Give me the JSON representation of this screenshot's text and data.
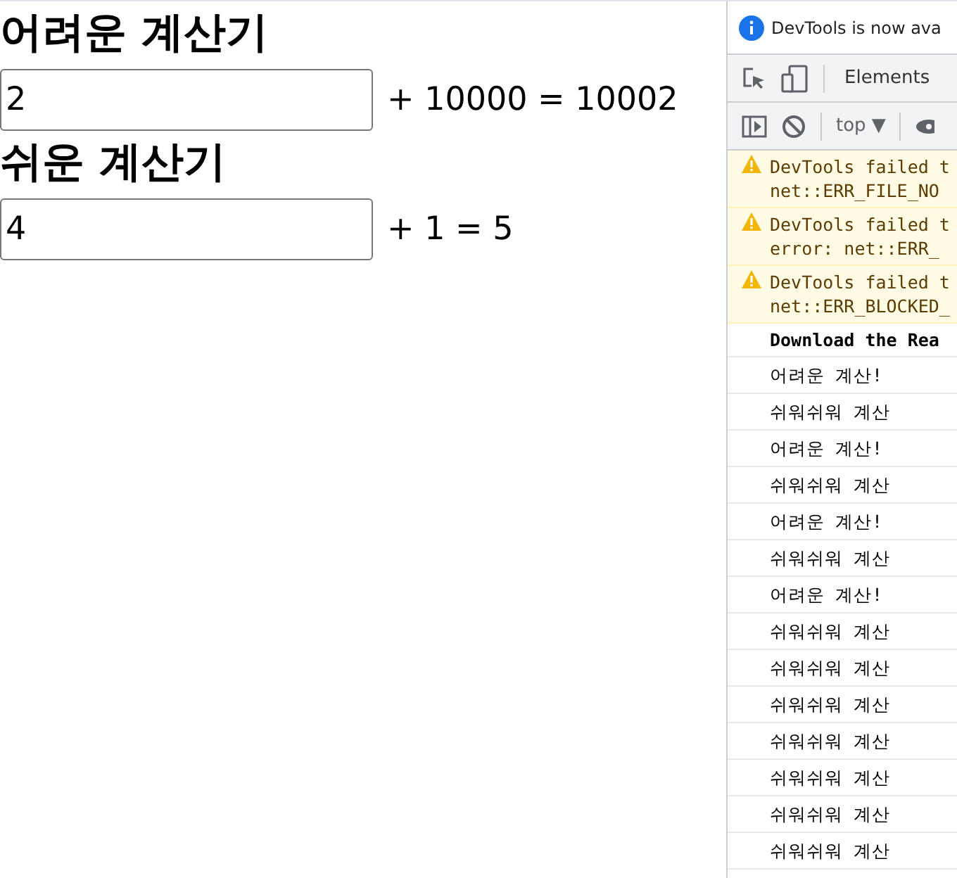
{
  "calculators": [
    {
      "title": "어려운 계산기",
      "value": "2",
      "equation": "+ 10000 = 10002"
    },
    {
      "title": "쉬운 계산기",
      "value": "4",
      "equation": "+ 1 = 5"
    }
  ],
  "devtools": {
    "banner": "DevTools is now ava",
    "tabs": [
      {
        "label": "Elements",
        "selected": false
      }
    ],
    "context": "top ▼",
    "console": [
      {
        "kind": "warning",
        "lines": [
          "DevTools failed t",
          "net::ERR_FILE_NO"
        ]
      },
      {
        "kind": "warning",
        "lines": [
          "DevTools failed t",
          "error: net::ERR_"
        ]
      },
      {
        "kind": "warning",
        "lines": [
          "DevTools failed t",
          "net::ERR_BLOCKED_"
        ]
      },
      {
        "kind": "info",
        "lines": [
          "Download the Rea"
        ]
      },
      {
        "kind": "log",
        "lines": [
          "어려운 계산!"
        ]
      },
      {
        "kind": "log",
        "lines": [
          "쉬워쉬워 계산"
        ]
      },
      {
        "kind": "log",
        "lines": [
          "어려운 계산!"
        ]
      },
      {
        "kind": "log",
        "lines": [
          "쉬워쉬워 계산"
        ]
      },
      {
        "kind": "log",
        "lines": [
          "어려운 계산!"
        ]
      },
      {
        "kind": "log",
        "lines": [
          "쉬워쉬워 계산"
        ]
      },
      {
        "kind": "log",
        "lines": [
          "어려운 계산!"
        ]
      },
      {
        "kind": "log",
        "lines": [
          "쉬워쉬워 계산"
        ]
      },
      {
        "kind": "log",
        "lines": [
          "쉬워쉬워 계산"
        ]
      },
      {
        "kind": "log",
        "lines": [
          "쉬워쉬워 계산"
        ]
      },
      {
        "kind": "log",
        "lines": [
          "쉬워쉬워 계산"
        ]
      },
      {
        "kind": "log",
        "lines": [
          "쉬워쉬워 계산"
        ]
      },
      {
        "kind": "log",
        "lines": [
          "쉬워쉬워 계산"
        ]
      },
      {
        "kind": "log",
        "lines": [
          "쉬워쉬워 계산"
        ]
      }
    ]
  }
}
